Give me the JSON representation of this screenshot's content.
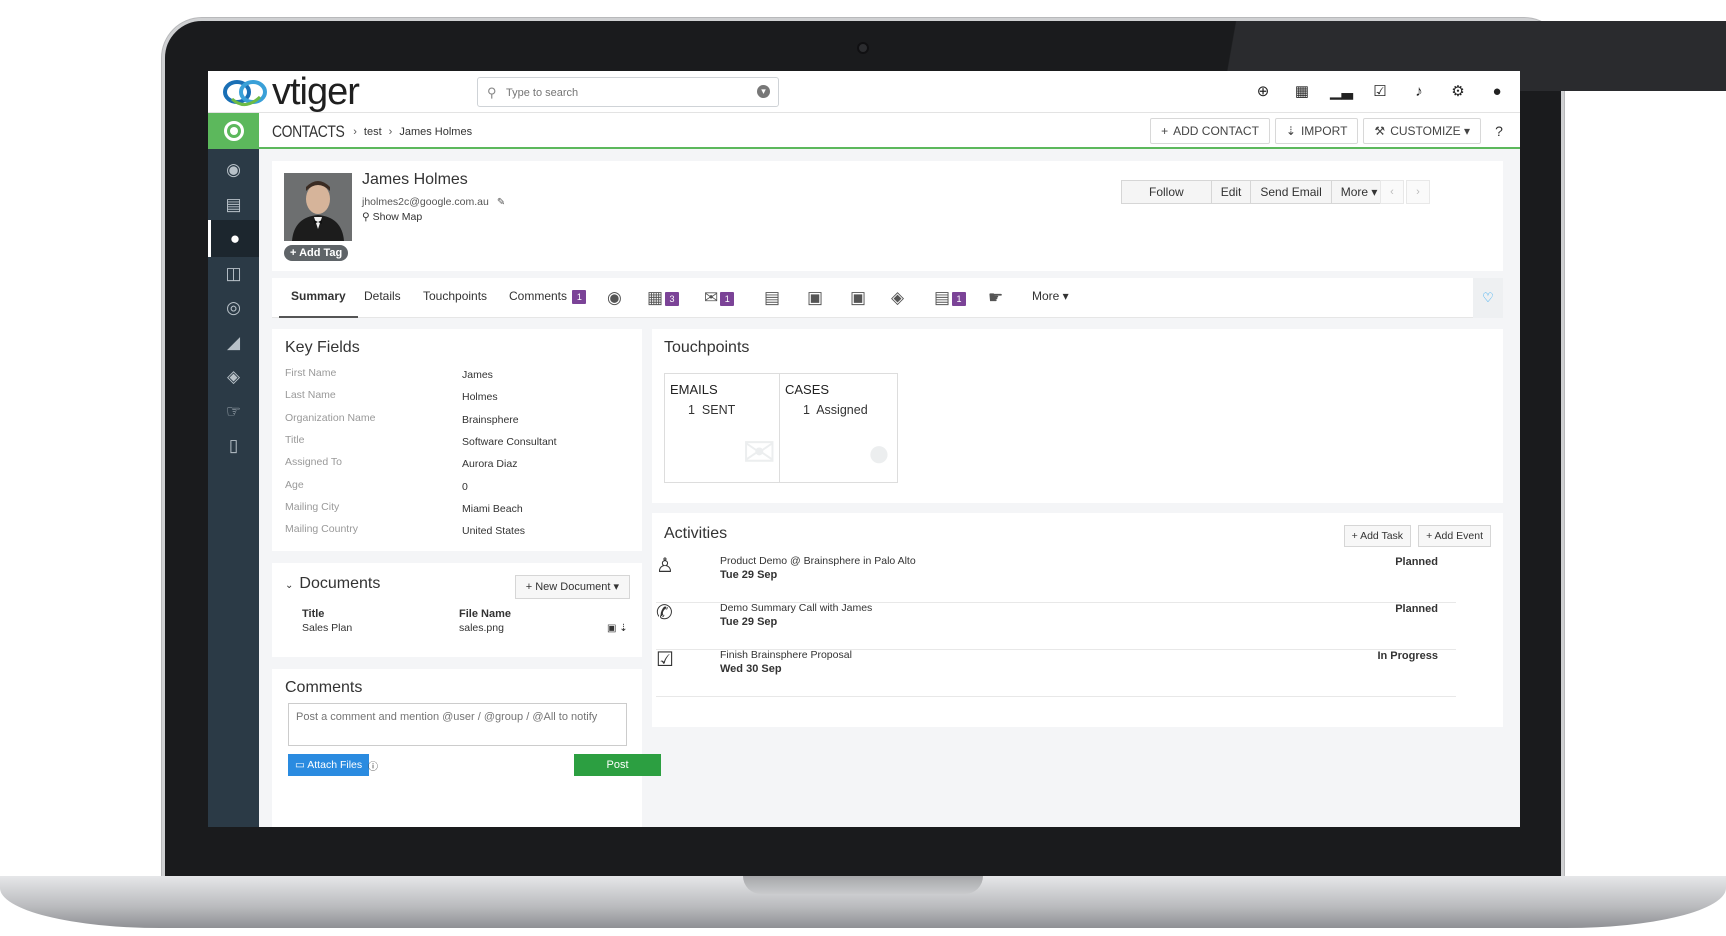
{
  "search": {
    "placeholder": "Type to search"
  },
  "logo": {
    "text": "vtiger"
  },
  "topbar": {
    "icons": [
      "plus-circle-icon",
      "calendar-icon",
      "bar-chart-icon",
      "check-square-icon",
      "bell-icon",
      "gear-icon",
      "user-icon"
    ]
  },
  "breadcrumb": {
    "module": "CONTACTS",
    "list": "test",
    "record": "James Holmes"
  },
  "module_buttons": {
    "add_contact": "ADD CONTACT",
    "import": "IMPORT",
    "customize": "CUSTOMIZE"
  },
  "record": {
    "name": "James Holmes",
    "email": "jholmes2c@google.com.au",
    "show_map": "Show Map",
    "add_tag": "Add Tag"
  },
  "record_buttons": {
    "follow": "Follow",
    "edit": "Edit",
    "send_email": "Send Email",
    "more": "More"
  },
  "tabs": {
    "summary": "Summary",
    "details": "Details",
    "touchpoints": "Touchpoints",
    "comments": "Comments",
    "comments_count": "1",
    "events_count": "3",
    "emails_count": "1",
    "notes_count": "1",
    "more": "More"
  },
  "key_fields": {
    "title": "Key Fields",
    "rows": [
      {
        "label": "First Name",
        "value": "James"
      },
      {
        "label": "Last Name",
        "value": "Holmes"
      },
      {
        "label": "Organization Name",
        "value": "Brainsphere"
      },
      {
        "label": "Title",
        "value": "Software Consultant"
      },
      {
        "label": "Assigned To",
        "value": "Aurora Diaz"
      },
      {
        "label": "Age",
        "value": "0"
      },
      {
        "label": "Mailing City",
        "value": "Miami Beach"
      },
      {
        "label": "Mailing Country",
        "value": "United States"
      }
    ]
  },
  "documents": {
    "title": "Documents",
    "new_document": "New Document",
    "col_title": "Title",
    "col_file": "File Name",
    "rows": [
      {
        "title": "Sales Plan",
        "file": "sales.png"
      }
    ]
  },
  "comments": {
    "title": "Comments",
    "placeholder": "Post a comment and mention @user / @group / @All to notify",
    "attach": "Attach Files",
    "post": "Post"
  },
  "touchpoints": {
    "title": "Touchpoints",
    "cards": [
      {
        "heading": "EMAILS",
        "count": "1",
        "status": "SENT"
      },
      {
        "heading": "CASES",
        "count": "1",
        "status": "Assigned"
      }
    ]
  },
  "activities": {
    "title": "Activities",
    "add_task": "Add Task",
    "add_event": "Add Event",
    "items": [
      {
        "icon": "meeting-icon",
        "title": "Product Demo @ Brainsphere in Palo Alto",
        "date": "Tue 29 Sep",
        "status": "Planned"
      },
      {
        "icon": "phone-icon",
        "title": "Demo Summary Call with James",
        "date": "Tue 29 Sep",
        "status": "Planned"
      },
      {
        "icon": "task-icon",
        "title": "Finish Brainsphere Proposal",
        "date": "Wed 30 Sep",
        "status": "In Progress"
      }
    ]
  },
  "colors": {
    "accent": "#5cb85c",
    "sidebar": "#2b3a46",
    "badge": "#7b4397",
    "post": "#2c9f41",
    "attach": "#2a8be0"
  }
}
